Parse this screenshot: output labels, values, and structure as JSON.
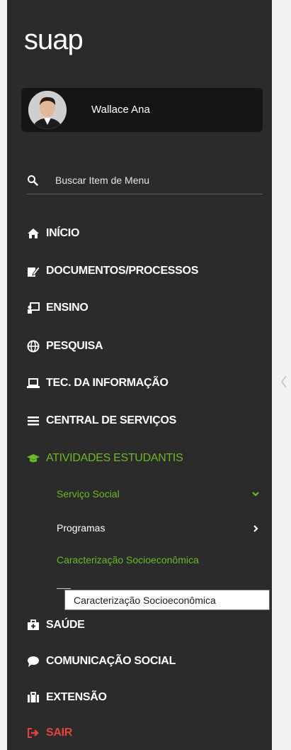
{
  "app": {
    "logo_text": "suap"
  },
  "user": {
    "name": "Wallace Ana"
  },
  "search": {
    "placeholder": "Buscar Item de Menu"
  },
  "menu": {
    "items": [
      {
        "label": "INÍCIO",
        "icon": "home-icon"
      },
      {
        "label": "DOCUMENTOS/PROCESSOS",
        "icon": "document-edit-icon"
      },
      {
        "label": "ENSINO",
        "icon": "chalkboard-icon"
      },
      {
        "label": "PESQUISA",
        "icon": "globe-icon"
      },
      {
        "label": "TEC. DA INFORMAÇÃO",
        "icon": "laptop-icon"
      },
      {
        "label": "CENTRAL DE SERVIÇOS",
        "icon": "list-icon"
      },
      {
        "label": "ATIVIDADES ESTUDANTIS",
        "icon": "graduation-cap-icon",
        "active": true
      },
      {
        "label": "SAÚDE",
        "icon": "medkit-icon"
      },
      {
        "label": "COMUNICAÇÃO SOCIAL",
        "icon": "speech-bubble-icon"
      },
      {
        "label": "EXTENSÃO",
        "icon": "briefcase-icon"
      },
      {
        "label": "SAIR",
        "icon": "sign-out-icon"
      }
    ],
    "submenu": [
      {
        "label": "Serviço Social",
        "state": "expanded"
      },
      {
        "label": "Programas",
        "state": "collapsed"
      },
      {
        "label": "Caracterização Socioeconômica",
        "state": "selected"
      }
    ]
  },
  "tooltip": {
    "text": "Caracterização Socioeconômica"
  },
  "colors": {
    "sidebar_bg": "#2b2b2b",
    "accent_green": "#6cb827",
    "exit_red": "#e8403a",
    "user_card_bg": "#151515"
  }
}
